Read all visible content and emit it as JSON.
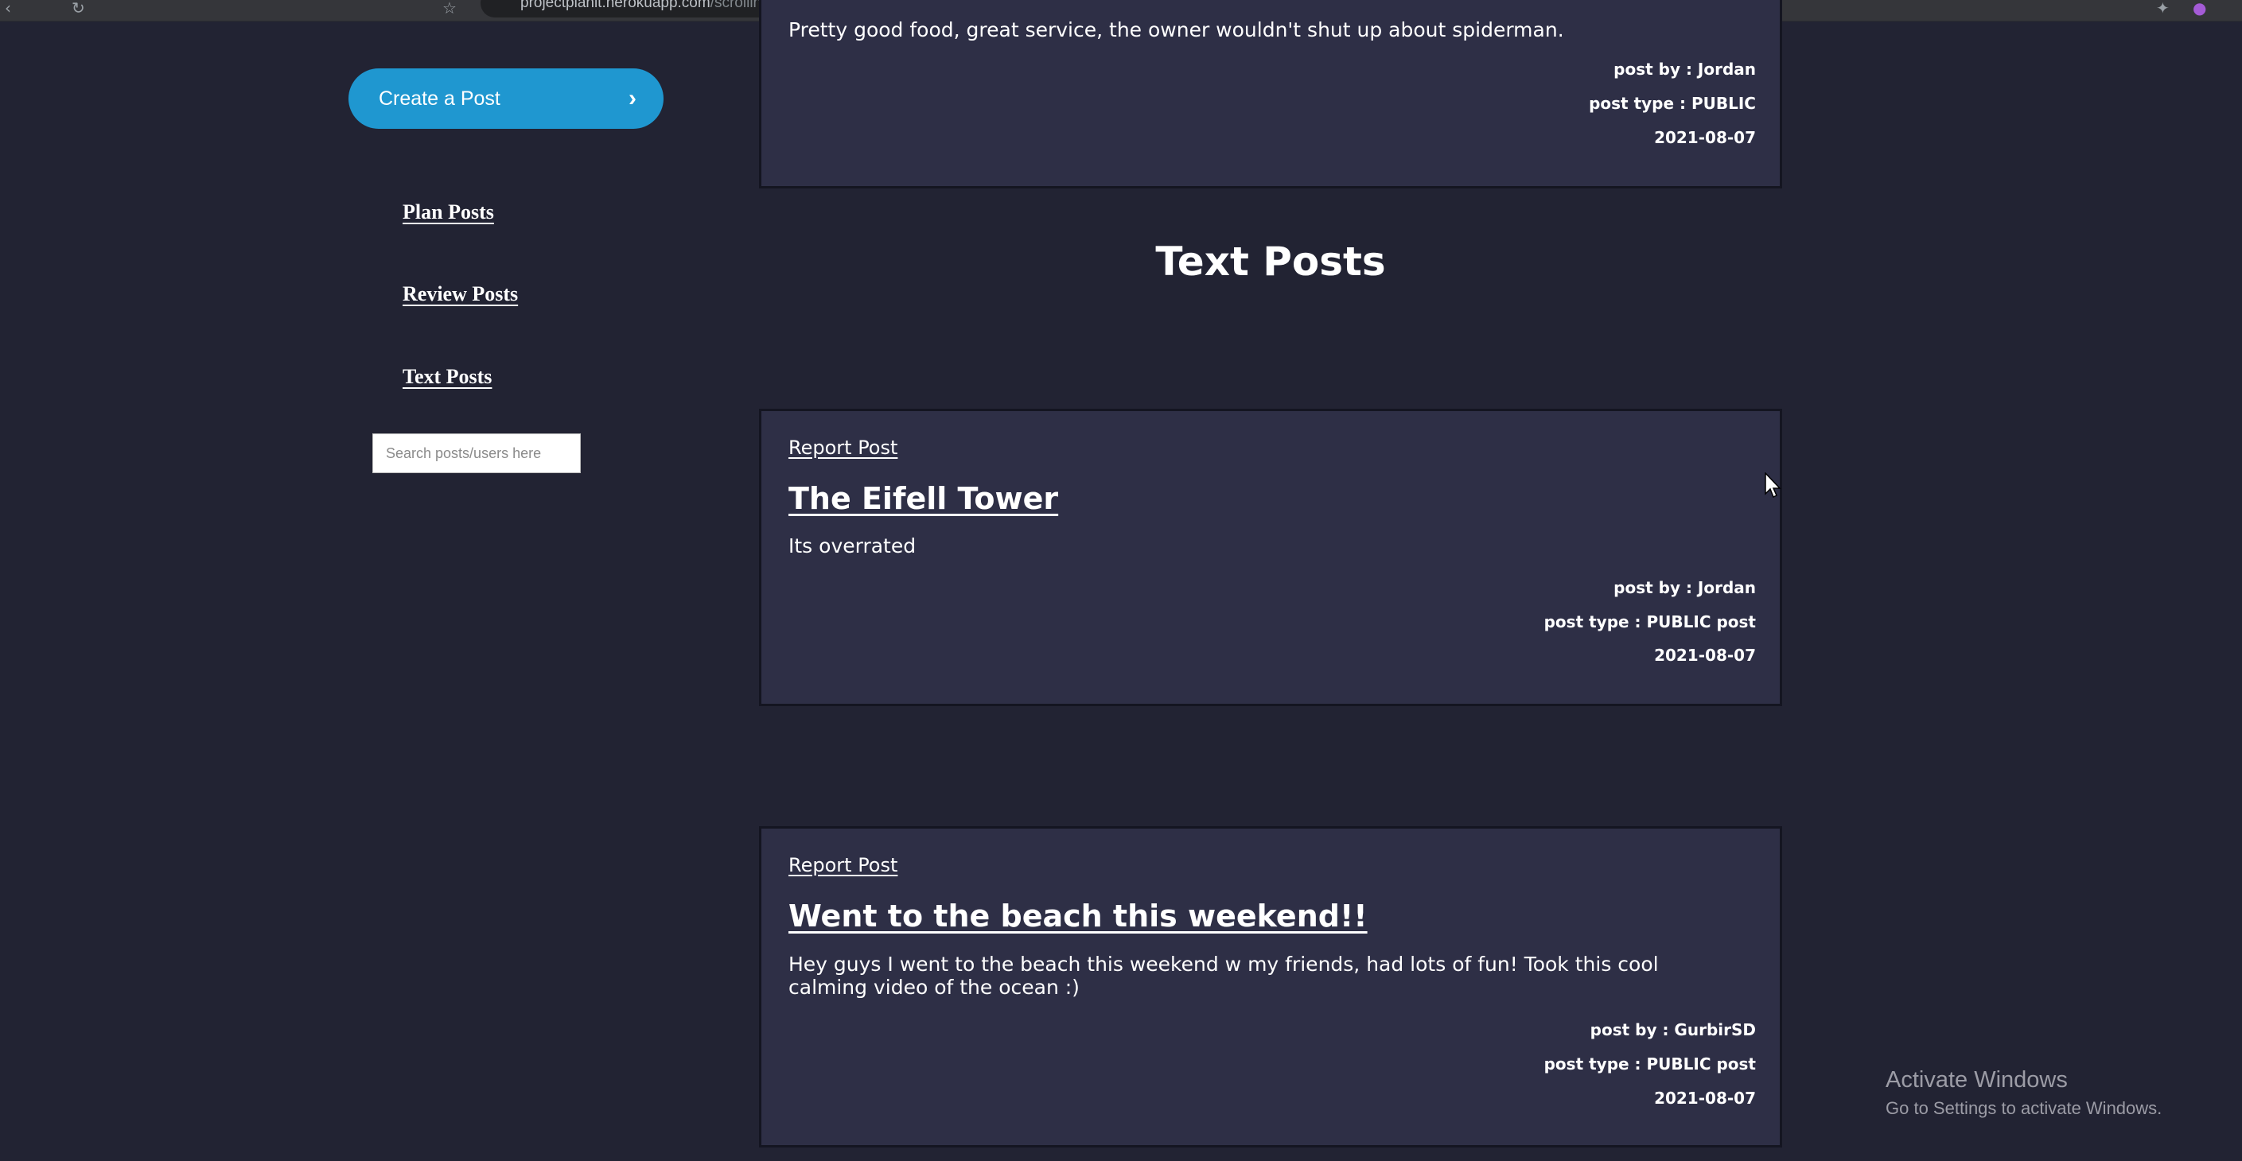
{
  "browser": {
    "url_host": "projectplanit.herokuapp.com",
    "url_path": "/scrollingfeed"
  },
  "sidebar": {
    "create_label": "Create a Post",
    "links": [
      "Plan Posts",
      "Review Posts",
      "Text Posts"
    ],
    "search_placeholder": "Search posts/users here"
  },
  "previous_post": {
    "body": "Pretty good food, great service, the owner wouldn't shut up about spiderman.",
    "post_by": "post by : Jordan",
    "post_type": "post type : PUBLIC",
    "date": "2021-08-07"
  },
  "section_title": "Text Posts",
  "posts": [
    {
      "report": "Report Post",
      "title": "The Eifell Tower",
      "body": "Its overrated",
      "post_by": "post by : Jordan",
      "post_type": "post type : PUBLIC post",
      "date": "2021-08-07"
    },
    {
      "report": "Report Post",
      "title": "Went to the beach this weekend!!",
      "body": "Hey guys I went to the beach this weekend w my friends, had lots of fun! Took this cool calming video of the ocean :)",
      "post_by": "post by : GurbirSD",
      "post_type": "post type : PUBLIC post",
      "date": "2021-08-07"
    }
  ],
  "watermark": {
    "line1": "Activate Windows",
    "line2": "Go to Settings to activate Windows."
  }
}
